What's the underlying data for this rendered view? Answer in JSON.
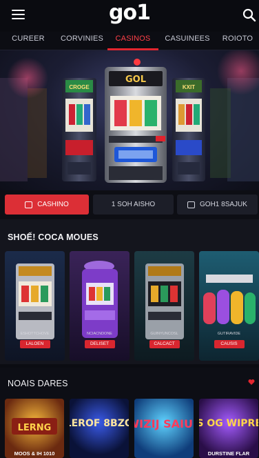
{
  "header": {
    "logo_text": "go1",
    "menu_icon": "hamburger-icon",
    "search_icon": "search-icon"
  },
  "tabs": [
    {
      "label": "CUREER",
      "active": false
    },
    {
      "label": "CORVINIES",
      "active": false
    },
    {
      "label": "CASINOS",
      "active": true
    },
    {
      "label": "CASUINEES",
      "active": false
    },
    {
      "label": "ROIOTO",
      "active": false
    }
  ],
  "hero": {
    "machine_label": "GOL",
    "left_label": "CROGE",
    "right_label": "KXIT"
  },
  "actions": {
    "primary_label": "CASHINO",
    "secondary_label": "1   SOH AISHO",
    "tertiary_label": "GOH1 8SAJUK"
  },
  "section1": {
    "title": "SHOẾ! COCA MOUES",
    "cards": [
      {
        "label": "ESHOTTCHOVE",
        "button": "LALOEN"
      },
      {
        "label": "NCIACNDONE",
        "button": "DELISET"
      },
      {
        "label": "GUINYUNCOSL",
        "button": "CALCACT"
      },
      {
        "label": "GUTIRAVIDE",
        "button": "CAUSIS"
      }
    ]
  },
  "section2": {
    "title": "NOAIS DARES",
    "heart_icon": "heart-icon",
    "tiles": [
      {
        "title": "LERNG",
        "caption": "MOOS & IH 1010"
      },
      {
        "title": "ELEROF 8BZOZ",
        "caption": ""
      },
      {
        "title": "WIZIJ SAIUS",
        "caption": ""
      },
      {
        "title": "US OG WIPRES",
        "caption": "DURSTINE FLAR"
      }
    ]
  },
  "colors": {
    "accent": "#e3262f",
    "background": "#0b0c12"
  }
}
